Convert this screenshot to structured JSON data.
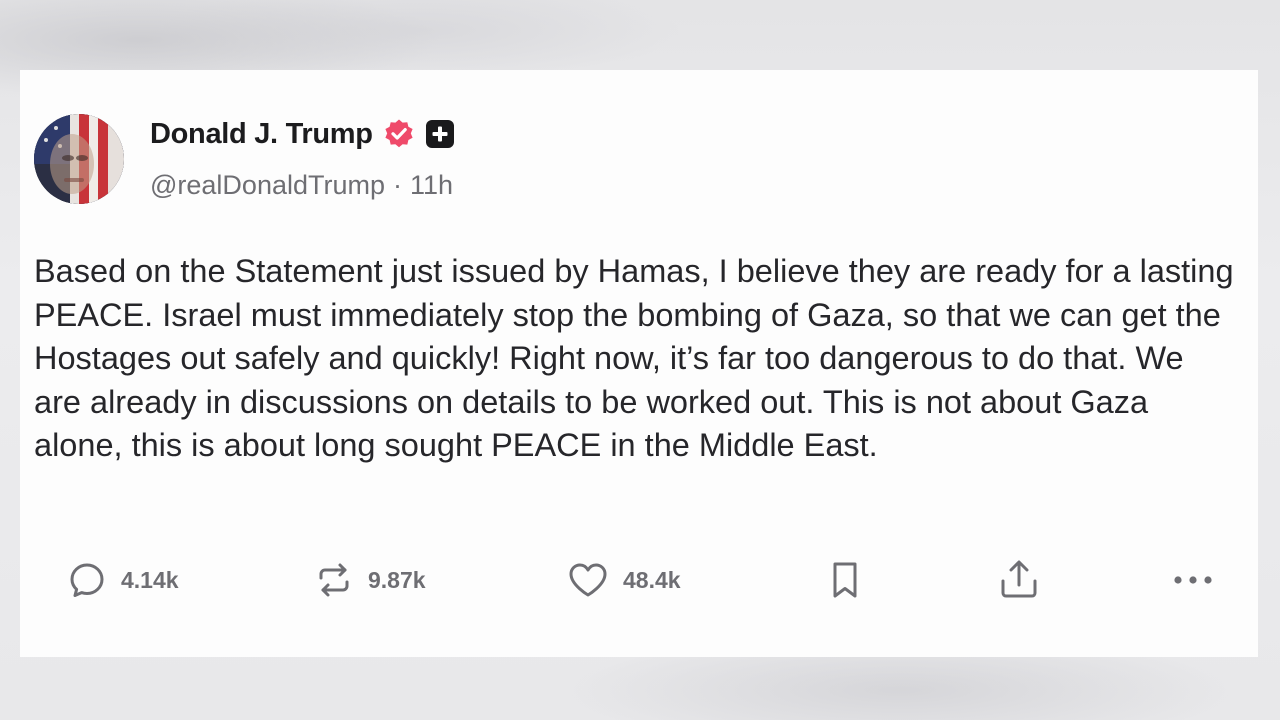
{
  "post": {
    "author": {
      "display_name": "Donald J. Trump",
      "handle": "@realDonaldTrump",
      "separator": "·",
      "time_ago": "11h",
      "verified_badge_icon": "verified-check-icon",
      "plus_badge_icon": "plus-badge-icon",
      "avatar_icon": "profile-avatar"
    },
    "text": "Based on the Statement just issued by Hamas, I believe they are ready for a lasting PEACE. Israel must immediately stop the bombing of Gaza, so that we can get the Hostages out safely and quickly! Right now, it’s far too dangerous to do that. We are already in discussions on details to be worked out. This is not about Gaza alone, this is about long sought PEACE in the Middle East.",
    "actions": {
      "replies": {
        "icon": "comment-icon",
        "count": "4.14k"
      },
      "reposts": {
        "icon": "repost-icon",
        "count": "9.87k"
      },
      "likes": {
        "icon": "heart-icon",
        "count": "48.4k"
      },
      "bookmark": {
        "icon": "bookmark-icon"
      },
      "share": {
        "icon": "share-icon"
      },
      "more": {
        "icon": "more-icon"
      }
    }
  },
  "colors": {
    "verified_badge": "#ef4a6a",
    "plus_badge": "#1a1a1c",
    "text_primary": "#26262a",
    "text_secondary": "#6e6e73",
    "card_background": "#fdfdfd"
  }
}
